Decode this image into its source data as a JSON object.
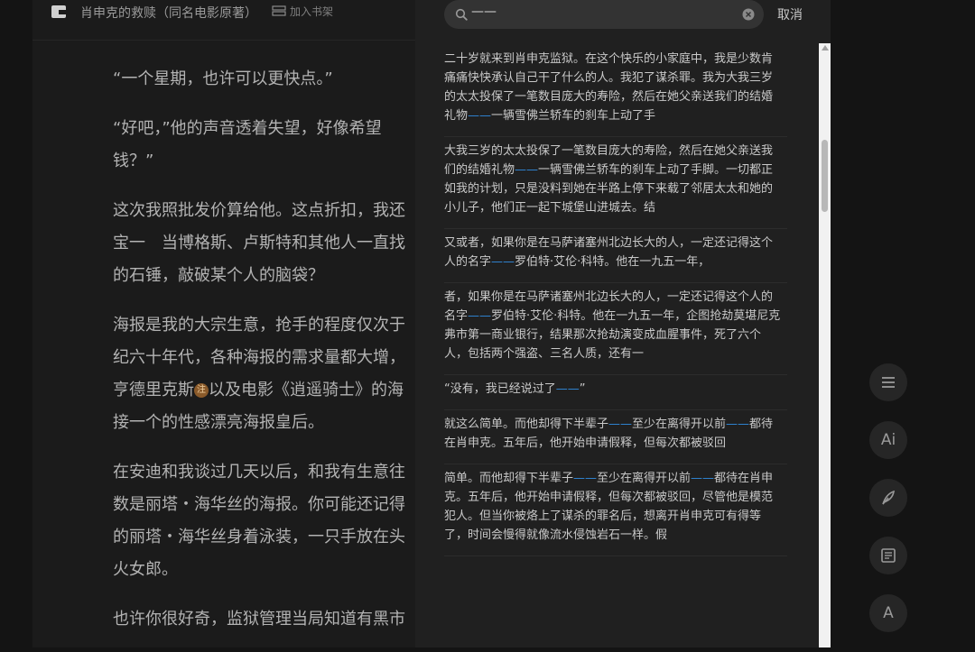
{
  "reader": {
    "book_title": "肖申克的救赎（同名电影原著）",
    "add_to_shelf": "加入书架",
    "paragraphs": [
      {
        "lines": [
          "“一个星期，也许可以更快点。”"
        ]
      },
      {
        "lines": [
          "“好吧，”他的声音透着失望，好像希望",
          "钱？”"
        ]
      },
      {
        "lines": [
          "这次我照批发价算给他。这点折扣，我还",
          "宝一　当博格斯、卢斯特和其他人一直找",
          "的石锤，敲破某个人的脑袋？"
        ]
      },
      {
        "lines": [
          "海报是我的大宗生意，抢手的程度仅次于",
          "纪六十年代，各种海报的需求量都大增，",
          "亨德里克斯",
          "接一个的性感漂亮海报皇后。"
        ],
        "note_badge": "注",
        "line3_tail": "以及电影《逍遥骑士》的海"
      },
      {
        "lines": [
          "在安迪和我谈过几天以后，和我有生意往",
          "数是丽塔・海华丝的海报。你可能还记得",
          "的丽塔・海华丝身着泳装，一只手放在头",
          "火女郎。"
        ]
      },
      {
        "lines": [
          "也许你很好奇，监狱管理当局知道有黑市"
        ]
      }
    ]
  },
  "search": {
    "query": "——",
    "cancel_label": "取消"
  },
  "results": [
    {
      "lines": [
        [
          {
            "t": "二十岁就来到肖申克监狱。在这个快乐的小家庭中，我是少数肯"
          }
        ],
        [
          {
            "t": "痛痛快快承认自己干了什么的人。我犯了谋杀罪。我为大我三岁"
          }
        ],
        [
          {
            "t": "的太太投保了一笔数目庞大的寿险，然后在她父亲送我们的结婚"
          }
        ],
        [
          {
            "t": "礼物"
          },
          {
            "t": "——",
            "h": true
          },
          {
            "t": "一辆雪佛兰轿车的刹车上动了手"
          }
        ]
      ]
    },
    {
      "lines": [
        [
          {
            "t": "大我三岁的太太投保了一笔数目庞大的寿险，然后在她父亲送我"
          }
        ],
        [
          {
            "t": "们的结婚礼物"
          },
          {
            "t": "——",
            "h": true
          },
          {
            "t": "一辆雪佛兰轿车的刹车上动了手脚。一切都正"
          }
        ],
        [
          {
            "t": "如我的计划，只是没料到她在半路上停下来载了邻居太太和她的"
          }
        ],
        [
          {
            "t": "小儿子，他们正一起下城堡山进城去。结"
          }
        ]
      ]
    },
    {
      "lines": [
        [
          {
            "t": "又或者，如果你是在马萨诸塞州北边长大的人，一定还记得这个"
          }
        ],
        [
          {
            "t": "人的名字"
          },
          {
            "t": "——",
            "h": true
          },
          {
            "t": "罗伯特·艾伦·科特。他在一九五一年，"
          }
        ]
      ]
    },
    {
      "lines": [
        [
          {
            "t": "者，如果你是在马萨诸塞州北边长大的人，一定还记得这个人的"
          }
        ],
        [
          {
            "t": "名字"
          },
          {
            "t": "——",
            "h": true
          },
          {
            "t": "罗伯特·艾伦·科特。他在一九五一年，企图抢劫莫堪尼克"
          }
        ],
        [
          {
            "t": "弗市第一商业银行，结果那次抢劫演变成血腥事件，死了六个"
          }
        ],
        [
          {
            "t": "人，包括两个强盗、三名人质，还有一"
          }
        ]
      ]
    },
    {
      "lines": [
        [
          {
            "t": "“没有，我已经说过了"
          },
          {
            "t": "——",
            "h": true
          },
          {
            "t": "”"
          }
        ]
      ]
    },
    {
      "lines": [
        [
          {
            "t": "就这么简单。而他却得下半辈子"
          },
          {
            "t": "——",
            "h": true
          },
          {
            "t": "至少在离得开以前"
          },
          {
            "t": "——",
            "h": true
          },
          {
            "t": "都待"
          }
        ],
        [
          {
            "t": "在肖申克。五年后，他开始申请假释，但每次都被驳回"
          }
        ]
      ]
    },
    {
      "lines": [
        [
          {
            "t": "简单。而他却得下半辈子"
          },
          {
            "t": "——",
            "h": true
          },
          {
            "t": "至少在离得开以前"
          },
          {
            "t": "——",
            "h": true
          },
          {
            "t": "都待在肖申"
          }
        ],
        [
          {
            "t": "克。五年后，他开始申请假释，但每次都被驳回，尽管他是模范"
          }
        ],
        [
          {
            "t": "犯人。但当你被烙上了谋杀的罪名后，想离开肖申克可有得等"
          }
        ],
        [
          {
            "t": "了，时间会慢得就像流水侵蚀岩石一样。假"
          }
        ]
      ]
    }
  ],
  "toolbar": {
    "ai_label": "Ai",
    "font_label": "A"
  },
  "colors": {
    "highlight": "#2f86d6",
    "panel_bg": "#202020"
  }
}
